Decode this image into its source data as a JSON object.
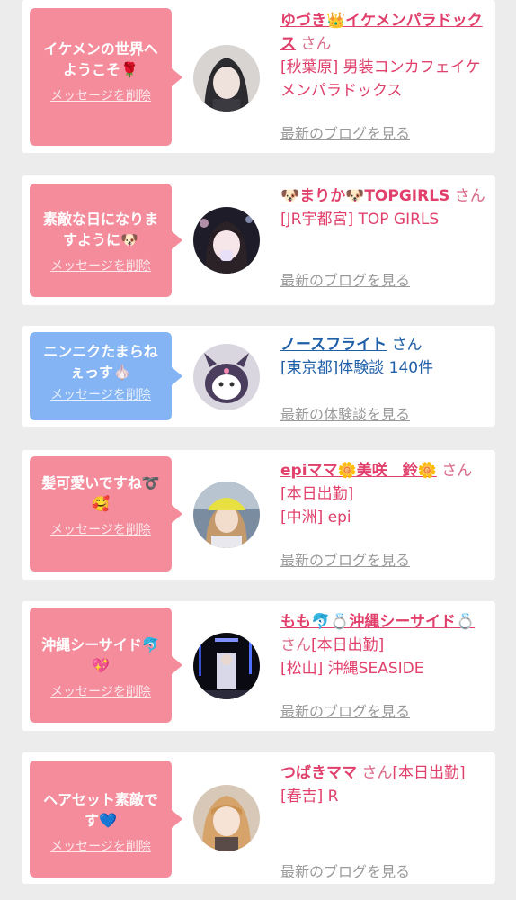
{
  "cards": [
    {
      "message": "イケメンの世界へようこそ🌹",
      "delete_label": "メッセージを削除",
      "name": "ゆづき👑イケメンパラドックス",
      "honorific": "さん",
      "status": "",
      "shop": "[秋葉原] 男装コンカフェイケメンパラドックス",
      "link": "最新のブログを見る",
      "bubble_color": "#f48c9c"
    },
    {
      "message": "素敵な日になりますように🐶",
      "delete_label": "メッセージを削除",
      "name": "🐶まりか🐶TOPGIRLS",
      "honorific": "さん",
      "status": "",
      "shop": "[JR宇都宮] TOP GIRLS",
      "link": "最新のブログを見る",
      "bubble_color": "#f48c9c"
    },
    {
      "message": "ニンニクたまらねぇっす🧄",
      "delete_label": "メッセージを削除",
      "name": "ノースフライト",
      "honorific": "さん",
      "status": "",
      "shop": "[東京都]体験談 140件",
      "link": "最新の体験談を見る",
      "bubble_color": "#84b4f4"
    },
    {
      "message": "髪可愛いですね➰🥰",
      "delete_label": "メッセージを削除",
      "name": "epiママ🌼美咲　鈴🌼",
      "honorific": "さん",
      "status": "[本日出勤]",
      "shop": "[中洲] epi",
      "link": "最新のブログを見る",
      "bubble_color": "#f48c9c"
    },
    {
      "message": "沖縄シーサイド🐬💖",
      "delete_label": "メッセージを削除",
      "name": "もも🐬💍沖縄シーサイド💍",
      "honorific": "さん",
      "status": "[本日出勤]",
      "shop": "[松山] 沖縄SEASIDE",
      "link": "最新のブログを見る",
      "bubble_color": "#f48c9c"
    },
    {
      "message": "ヘアセット素敵です💙",
      "delete_label": "メッセージを削除",
      "name": "つばきママ",
      "honorific": "さん",
      "status": "[本日出勤]",
      "shop": "[春吉] R",
      "link": "最新のブログを見る",
      "bubble_color": "#f48c9c"
    }
  ]
}
